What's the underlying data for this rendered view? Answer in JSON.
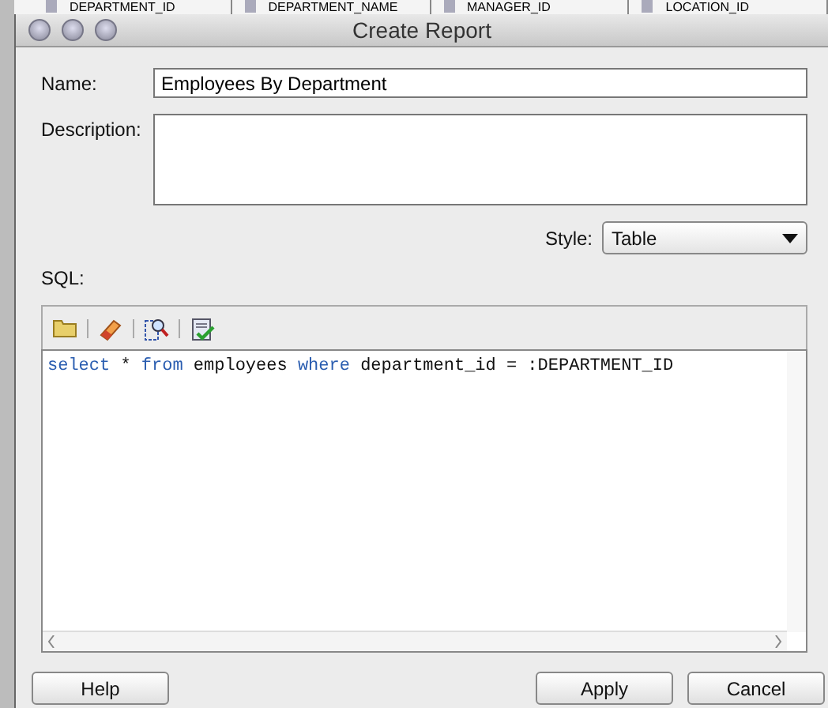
{
  "background_table": {
    "columns": [
      "DEPARTMENT_ID",
      "DEPARTMENT_NAME",
      "MANAGER_ID",
      "LOCATION_ID"
    ]
  },
  "window": {
    "title": "Create Report"
  },
  "name_field": {
    "label": "Name:",
    "value": "Employees By Department"
  },
  "description_field": {
    "label": "Description:"
  },
  "style_field": {
    "label": "Style:",
    "value": "Table"
  },
  "sql": {
    "label": "SQL:",
    "tokens": [
      {
        "kind": "keyword",
        "text": "select"
      },
      {
        "kind": "plain",
        "text": " * "
      },
      {
        "kind": "keyword",
        "text": "from"
      },
      {
        "kind": "plain",
        "text": " employees "
      },
      {
        "kind": "keyword",
        "text": "where"
      },
      {
        "kind": "plain",
        "text": " department_id = :DEPARTMENT_ID"
      }
    ]
  },
  "left_buttons": [
    {
      "label": "Help"
    }
  ],
  "right_buttons": [
    {
      "label": "Apply"
    },
    {
      "label": "Cancel"
    }
  ]
}
